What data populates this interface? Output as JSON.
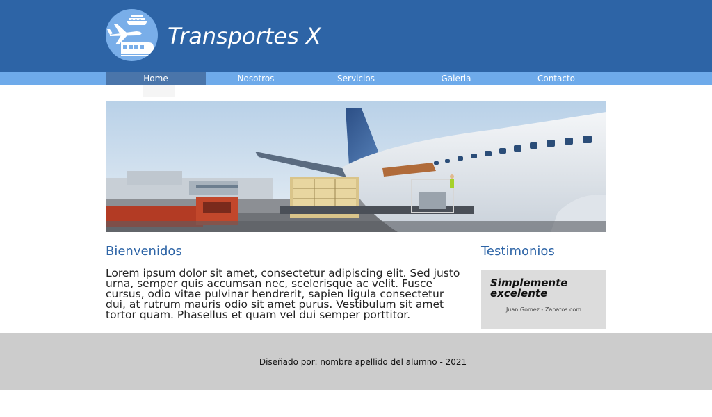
{
  "header": {
    "title": "Transportes X",
    "logo_icon": "airplane-train-ship-logo-icon"
  },
  "nav": {
    "items": [
      {
        "label": "Home",
        "active": true
      },
      {
        "label": "Nosotros",
        "active": false
      },
      {
        "label": "Servicios",
        "active": false
      },
      {
        "label": "Galeria",
        "active": false
      },
      {
        "label": "Contacto",
        "active": false
      }
    ]
  },
  "hero": {
    "image": "cargo-plane-loading-photo"
  },
  "main": {
    "heading": "Bienvenidos",
    "paragraph": "Lorem ipsum dolor sit amet, consectetur adipiscing elit. Sed justo urna, semper quis accumsan nec, scelerisque ac velit. Fusce cursus, odio vitae pulvinar hendrerit, sapien ligula consectetur dui, at rutrum mauris odio sit amet purus. Vestibulum sit amet tortor quam. Phasellus et quam vel dui semper porttitor."
  },
  "sidebar": {
    "heading": "Testimonios",
    "quote": "Simplemente excelente",
    "author": "Juan Gomez - Zapatos.com"
  },
  "footer": {
    "text": "Diseñado por: nombre apellido del alumno - 2021"
  },
  "colors": {
    "header_bg": "#2d64a6",
    "nav_bg": "#6eaaea",
    "nav_active_bg": "#4a75aa",
    "heading_color": "#2d64a6",
    "footer_bg": "#cccccc",
    "testimonial_bg": "#dcdcdc"
  }
}
